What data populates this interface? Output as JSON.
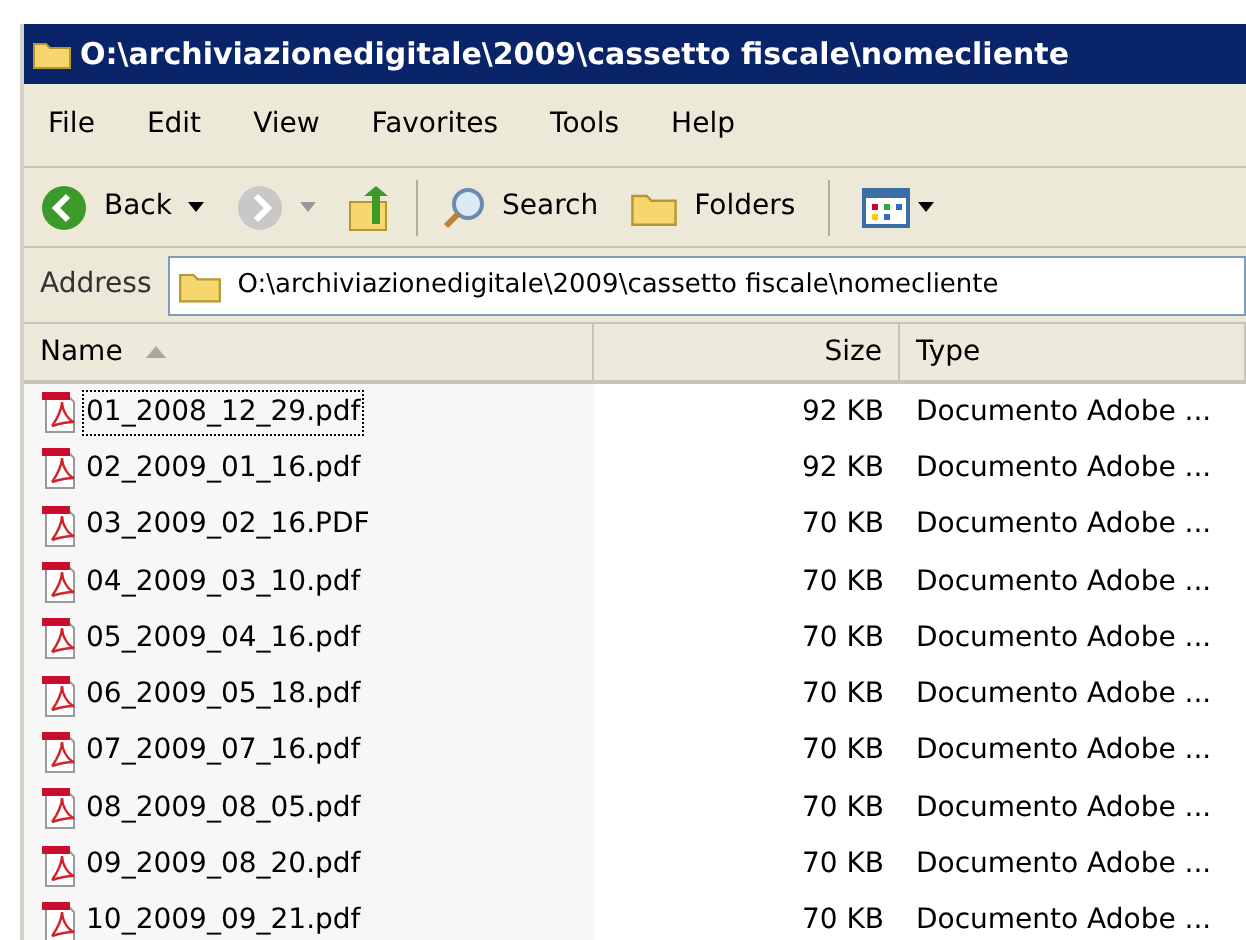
{
  "window": {
    "title": "O:\\archiviazionedigitale\\2009\\cassetto fiscale\\nomecliente"
  },
  "menu": [
    "File",
    "Edit",
    "View",
    "Favorites",
    "Tools",
    "Help"
  ],
  "toolbar": {
    "back": "Back",
    "search": "Search",
    "folders": "Folders"
  },
  "address": {
    "label": "Address",
    "value": "O:\\archiviazionedigitale\\2009\\cassetto fiscale\\nomecliente"
  },
  "columns": [
    {
      "label": "Name",
      "sorted": true
    },
    {
      "label": "Size",
      "sorted": false
    },
    {
      "label": "Type",
      "sorted": false
    }
  ],
  "rows": [
    {
      "name": "01_2008_12_29.pdf",
      "size": "92 KB",
      "type": "Documento Adobe ...",
      "focused": true
    },
    {
      "name": "02_2009_01_16.pdf",
      "size": "92 KB",
      "type": "Documento Adobe ...",
      "focused": false
    },
    {
      "name": "03_2009_02_16.PDF",
      "size": "70 KB",
      "type": "Documento Adobe ...",
      "focused": false
    },
    {
      "name": "04_2009_03_10.pdf",
      "size": "70 KB",
      "type": "Documento Adobe ...",
      "focused": false
    },
    {
      "name": "05_2009_04_16.pdf",
      "size": "70 KB",
      "type": "Documento Adobe ...",
      "focused": false
    },
    {
      "name": "06_2009_05_18.pdf",
      "size": "70 KB",
      "type": "Documento Adobe ...",
      "focused": false
    },
    {
      "name": "07_2009_07_16.pdf",
      "size": "70 KB",
      "type": "Documento Adobe ...",
      "focused": false
    },
    {
      "name": "08_2009_08_05.pdf",
      "size": "70 KB",
      "type": "Documento Adobe ...",
      "focused": false
    },
    {
      "name": "09_2009_08_20.pdf",
      "size": "70 KB",
      "type": "Documento Adobe ...",
      "focused": false
    },
    {
      "name": "10_2009_09_21.pdf",
      "size": "70 KB",
      "type": "Documento Adobe ...",
      "focused": false
    }
  ]
}
